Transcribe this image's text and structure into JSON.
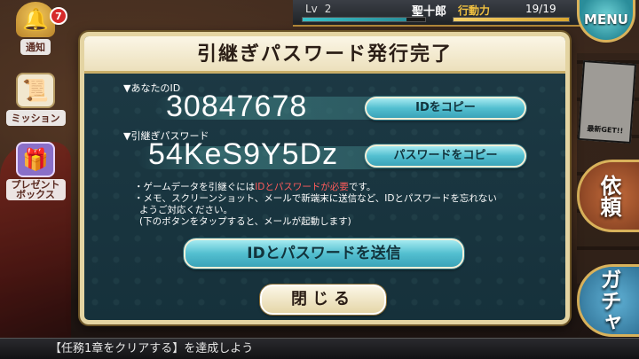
{
  "topbar": {
    "level_label": "Lv",
    "level_value": "2",
    "exp_fraction": 0.85,
    "player_name": "聖十郎",
    "ap_label": "行動力",
    "ap_value": "19/19",
    "ap_fraction": 1.0,
    "menu_label": "MENU"
  },
  "sidebar": {
    "notice": {
      "label": "通知",
      "badge": "7",
      "icon": "bell-icon"
    },
    "mission": {
      "label": "ミッション",
      "icon": "scroll-icon"
    },
    "present": {
      "label": "プレゼント\nボックス",
      "icon": "gift-icon"
    }
  },
  "right_menu": {
    "request_label": "依頼",
    "gacha_label": "ガチャ"
  },
  "background": {
    "manga_caption": "最新GET!!"
  },
  "dialog": {
    "title": "引継ぎパスワード発行完了",
    "id_label": "▼あなたのID",
    "id_value": "30847678",
    "copy_id_button": "IDをコピー",
    "password_label": "▼引継ぎパスワード",
    "password_value": "54KeS9Y5Dz",
    "copy_password_button": "パスワードをコピー",
    "note_line1_prefix": "・ゲームデータを引継ぐには",
    "note_line1_red": "IDとパスワードが必要",
    "note_line1_suffix": "です。",
    "note_line2": "・メモ、スクリーンショット、メールで新端末に送信など、IDとパスワードを忘れない",
    "note_line3": "ようご対応ください。",
    "note_line4": "(下のボタンをタップすると、メールが起動します)",
    "send_button": "IDとパスワードを送信",
    "close_button": "閉じる"
  },
  "ticker": {
    "text": "【任務1章をクリアする】を達成しよう"
  },
  "colors": {
    "dialog_bg": "#1d3a45",
    "accent_gold": "#d9b25b",
    "button_cyan": "#53bfd0",
    "warning_red": "#ff5b5b"
  }
}
